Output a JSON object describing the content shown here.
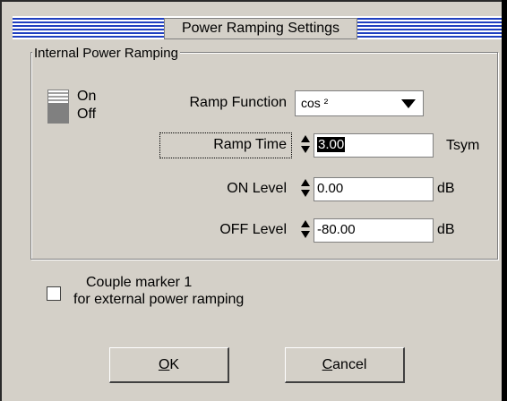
{
  "dialog": {
    "title": "Power Ramping Settings"
  },
  "group": {
    "label": "Internal Power Ramping"
  },
  "toggle": {
    "on_label": "On",
    "off_label": "Off",
    "state": "on"
  },
  "ramp_function": {
    "label": "Ramp Function",
    "value": "cos ²"
  },
  "ramp_time": {
    "label": "Ramp Time",
    "value": "3.00",
    "unit": "Tsym"
  },
  "on_level": {
    "label": "ON Level",
    "value": "0.00",
    "unit": "dB"
  },
  "off_level": {
    "label": "OFF Level",
    "value": "-80.00",
    "unit": "dB"
  },
  "couple_marker": {
    "line1": "Couple marker 1",
    "line2": "for external power ramping",
    "checked": false
  },
  "buttons": {
    "ok_mnemonic": "O",
    "ok_rest": "K",
    "cancel_mnemonic": "C",
    "cancel_rest": "ancel"
  }
}
